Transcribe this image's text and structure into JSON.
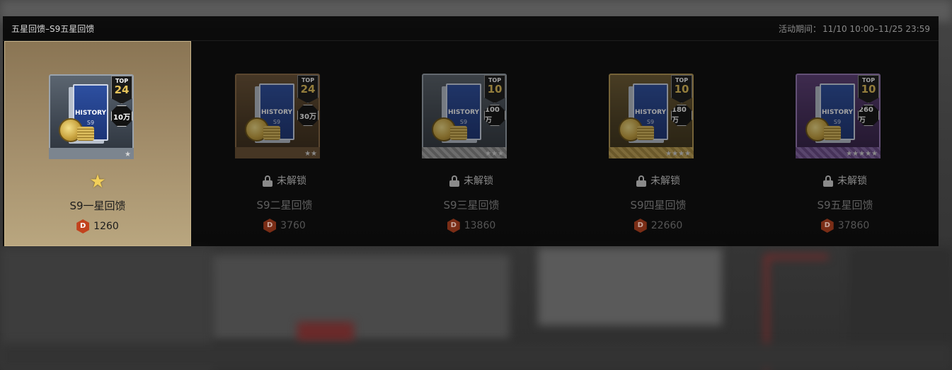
{
  "header": {
    "title": "五星回馈–S9五星回馈",
    "period_label": "活动期间：",
    "period_value": "11/10 10:00–11/25 23:59"
  },
  "tiers": [
    {
      "name": "S9一星回馈",
      "cost": "1260",
      "status": "unlocked",
      "top_label": "TOP",
      "top_value": "24",
      "amount": "10万",
      "card_text": "HISTORY",
      "card_sub": "S9",
      "stars": "★",
      "status_icon": "star-icon"
    },
    {
      "name": "S9二星回馈",
      "cost": "3760",
      "status": "locked",
      "lock_text": "未解锁",
      "top_label": "TOP",
      "top_value": "24",
      "amount": "30万",
      "card_text": "HISTORY",
      "card_sub": "S9",
      "stars": "★★"
    },
    {
      "name": "S9三星回馈",
      "cost": "13860",
      "status": "locked",
      "lock_text": "未解锁",
      "top_label": "TOP",
      "top_value": "10",
      "amount": "100万",
      "card_text": "HISTORY",
      "card_sub": "S9",
      "stars": "★★★"
    },
    {
      "name": "S9四星回馈",
      "cost": "22660",
      "status": "locked",
      "lock_text": "未解锁",
      "top_label": "TOP",
      "top_value": "10",
      "amount": "180万",
      "card_text": "HISTORY",
      "card_sub": "S9",
      "stars": "★★★★"
    },
    {
      "name": "S9五星回馈",
      "cost": "37860",
      "status": "locked",
      "lock_text": "未解锁",
      "top_label": "TOP",
      "top_value": "10",
      "amount": "260万",
      "card_text": "HISTORY",
      "card_sub": "S9",
      "stars": "★★★★★"
    }
  ],
  "currency_icon": "D",
  "colors": {
    "active_tier": "#a28d6a",
    "panel": "#080808",
    "token": "#c2421d",
    "star": "#f2cf5a"
  }
}
